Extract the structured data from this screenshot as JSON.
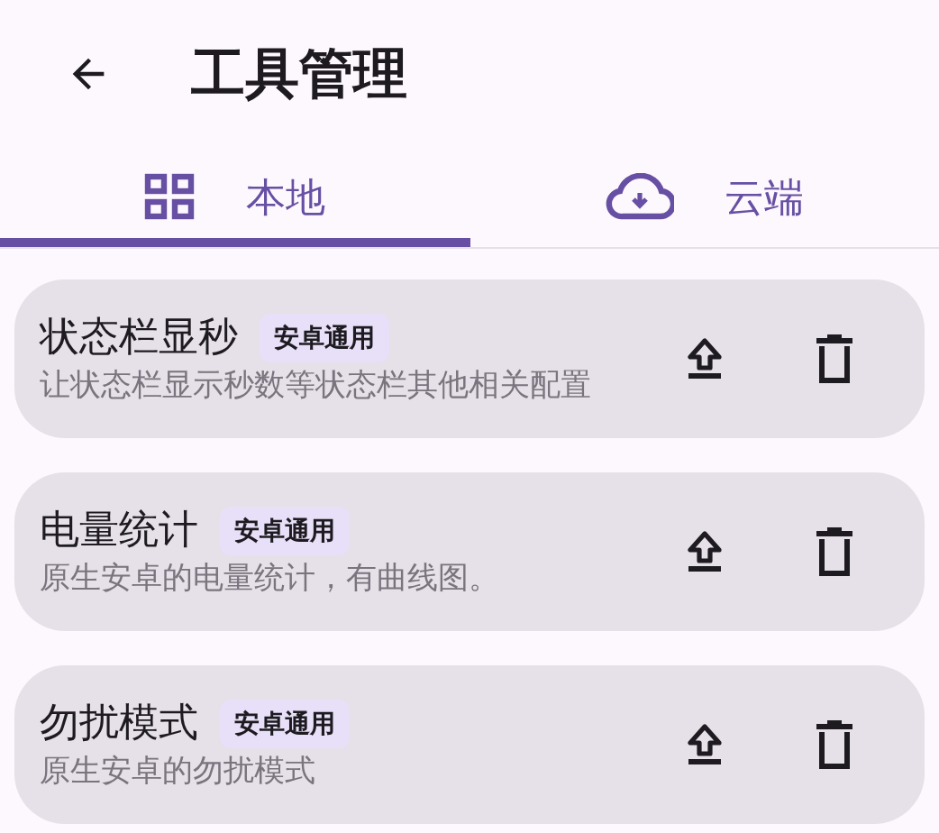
{
  "app_bar": {
    "title": "工具管理"
  },
  "tabs": [
    {
      "label": "本地",
      "selected": true
    },
    {
      "label": "云端",
      "selected": false
    }
  ],
  "tools": [
    {
      "name": "状态栏显秒",
      "tag": "安卓通用",
      "description": "让状态栏显示秒数等状态栏其他相关配置"
    },
    {
      "name": "电量统计",
      "tag": "安卓通用",
      "description": "原生安卓的电量统计，有曲线图。"
    },
    {
      "name": "勿扰模式",
      "tag": "安卓通用",
      "description": "原生安卓的勿扰模式"
    }
  ]
}
